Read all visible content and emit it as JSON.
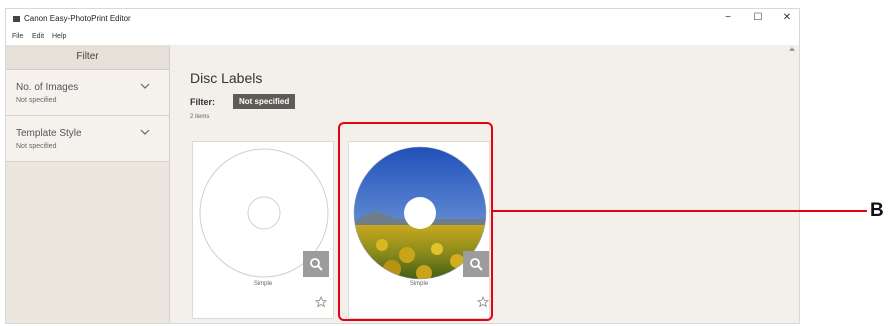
{
  "window": {
    "title": "Canon Easy-PhotoPrint Editor",
    "controls": {
      "minimize": "−",
      "maximize": "☐",
      "close": "✕"
    }
  },
  "menu": {
    "file": "File",
    "edit": "Edit",
    "help": "Help"
  },
  "sidebar": {
    "header": "Filter",
    "sections": [
      {
        "title": "No. of Images",
        "value": "Not specified"
      },
      {
        "title": "Template Style",
        "value": "Not specified"
      }
    ]
  },
  "main": {
    "title": "Disc Labels",
    "filter_label": "Filter:",
    "filter_value": "Not specified",
    "count": "2 items",
    "cards": [
      {
        "label": "Simple"
      },
      {
        "label": "Simple"
      }
    ]
  },
  "annotation": {
    "letter": "B",
    "color": "#e60012"
  },
  "icons": {
    "zoom": "magnifier-icon",
    "favorite": "star-icon",
    "chevron": "chevron-down-icon"
  }
}
